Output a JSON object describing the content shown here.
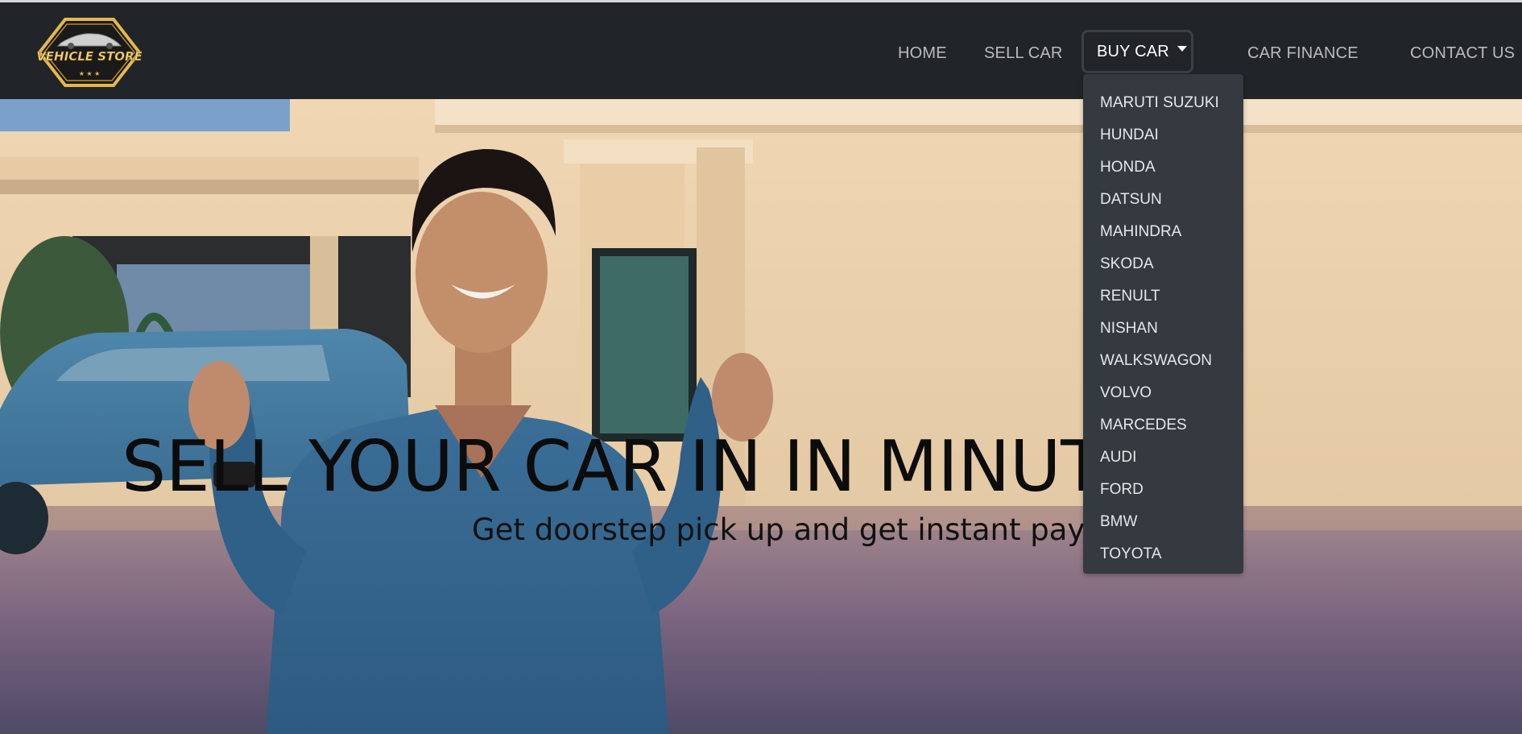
{
  "brand": {
    "logo_text": "VEHICLE STORE"
  },
  "nav": {
    "home": "HOME",
    "sell_car": "SELL CAR",
    "buy_car": "BUY CAR",
    "car_finance": "CAR FINANCE",
    "contact_us": "CONTACT US"
  },
  "dropdown": {
    "items": [
      "MARUTI SUZUKI",
      "HUNDAI",
      "HONDA",
      "DATSUN",
      "MAHINDRA",
      "SKODA",
      "RENULT",
      "NISHAN",
      "WALKSWAGON",
      "VOLVO",
      "MARCEDES",
      "AUDI",
      "FORD",
      "BMW",
      "TOYOTA"
    ]
  },
  "hero": {
    "title": "SELL YOUR CAR IN IN MINUTES",
    "subtitle": "Get doorstep pick up and get instant payment"
  },
  "colors": {
    "navbar_bg": "#212529",
    "dropdown_bg": "#343a40",
    "logo_gold": "#e4b84a"
  }
}
